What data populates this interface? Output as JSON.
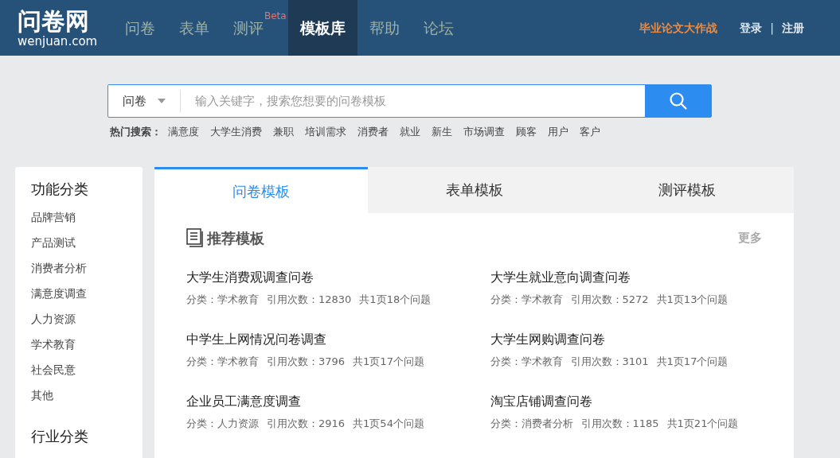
{
  "header": {
    "logo": {
      "title": "问卷网",
      "domain": "wenjuan.com"
    },
    "nav": [
      {
        "label": "问卷",
        "selected": false
      },
      {
        "label": "表单",
        "selected": false
      },
      {
        "label": "测评",
        "selected": false,
        "badge": "Beta"
      },
      {
        "label": "模板库",
        "selected": true
      },
      {
        "label": "帮助",
        "selected": false
      },
      {
        "label": "论坛",
        "selected": false
      }
    ],
    "promo": "毕业论文大作战",
    "login": "登录",
    "separator": "|",
    "register": "注册"
  },
  "search": {
    "type": "问卷",
    "placeholder": "输入关键字，搜索您想要的问卷模板"
  },
  "hot_search": {
    "label": "热门搜索：",
    "terms": [
      "满意度",
      "大学生消费",
      "兼职",
      "培训需求",
      "消费者",
      "就业",
      "新生",
      "市场调查",
      "顾客",
      "用户",
      "客户"
    ]
  },
  "sidebar": {
    "sections": [
      {
        "title": "功能分类",
        "items": [
          "品牌营销",
          "产品测试",
          "消费者分析",
          "满意度调查",
          "人力资源",
          "学术教育",
          "社会民意",
          "其他"
        ]
      },
      {
        "title": "行业分类"
      }
    ]
  },
  "tabs": [
    {
      "label": "问卷模板",
      "selected": true
    },
    {
      "label": "表单模板",
      "selected": false
    },
    {
      "label": "测评模板",
      "selected": false
    }
  ],
  "section": {
    "title": "推荐模板",
    "more": "更多"
  },
  "templates": [
    {
      "title": "大学生消费观调查问卷",
      "category": "分类：学术教育",
      "uses": "引用次数：12830",
      "questions": "共1页18个问题"
    },
    {
      "title": "大学生就业意向调查问卷",
      "category": "分类：学术教育",
      "uses": "引用次数：5272",
      "questions": "共1页13个问题"
    },
    {
      "title": "中学生上网情况问卷调查",
      "category": "分类：学术教育",
      "uses": "引用次数：3796",
      "questions": "共1页17个问题"
    },
    {
      "title": "大学生网购调查问卷",
      "category": "分类：学术教育",
      "uses": "引用次数：3101",
      "questions": "共1页17个问题"
    },
    {
      "title": "企业员工满意度调查",
      "category": "分类：人力资源",
      "uses": "引用次数：2916",
      "questions": "共1页54个问题"
    },
    {
      "title": "淘宝店铺调查问卷",
      "category": "分类：消费者分析",
      "uses": "引用次数：1185",
      "questions": "共1页21个问题"
    }
  ]
}
